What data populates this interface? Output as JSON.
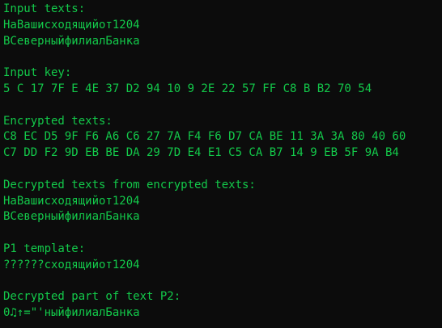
{
  "console": {
    "text_color": "#13c94a",
    "background_color": "#0c0c0c",
    "input_texts_label": "Input texts:",
    "input_texts": [
      "НаВашисходящийот1204",
      "ВСеверныйфилиалБанка"
    ],
    "input_key_label": "Input key:",
    "input_key": "5 C 17 7F E 4E 37 D2 94 10 9 2E 22 57 FF C8 B B2 70 54",
    "encrypted_texts_label": "Encrypted texts:",
    "encrypted_texts": [
      "C8 EC D5 9F F6 A6 C6 27 7A F4 F6 D7 CA BE 11 3A 3A 80 40 60",
      "C7 DD F2 9D EB BE DA 29 7D E4 E1 C5 CA B7 14 9 EB 5F 9A B4"
    ],
    "decrypted_texts_label": "Decrypted texts from encrypted texts:",
    "decrypted_texts": [
      "НаВашисходящийот1204",
      "ВСеверныйфилиалБанка"
    ],
    "p1_template_label": "P1 template:",
    "p1_template": "??????сходящийот1204",
    "decrypted_p2_label": "Decrypted part of text P2:",
    "decrypted_p2": "0♫↑=\"'ныйфилиалБанка"
  }
}
